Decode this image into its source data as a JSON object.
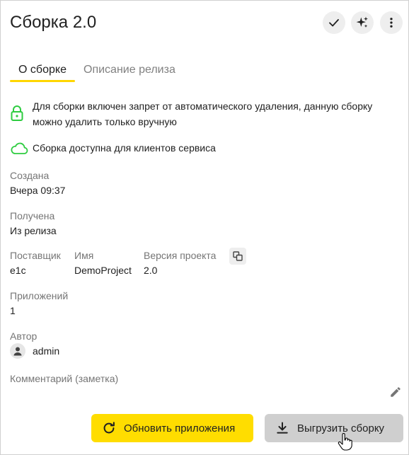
{
  "header": {
    "title": "Сборка 2.0",
    "actions": [
      {
        "name": "check-icon"
      },
      {
        "name": "sparkle-icon"
      },
      {
        "name": "more-vertical-icon"
      }
    ]
  },
  "tabs": [
    {
      "label": "О сборке",
      "active": true
    },
    {
      "label": "Описание релиза",
      "active": false
    }
  ],
  "notices": {
    "deletion_lock": "Для сборки включен запрет от автоматического удаления, данную сборку можно удалить только вручную",
    "availability": "Сборка доступна для клиентов сервиса"
  },
  "fields": {
    "created": {
      "label": "Создана",
      "value": "Вчера 09:37"
    },
    "received": {
      "label": "Получена",
      "value": "Из релиза"
    },
    "vendor": {
      "label": "Поставщик",
      "value": "e1c"
    },
    "name": {
      "label": "Имя",
      "value": "DemoProject"
    },
    "project_version": {
      "label": "Версия проекта",
      "value": "2.0"
    },
    "apps_count": {
      "label": "Приложений",
      "value": "1"
    },
    "author": {
      "label": "Автор",
      "value": "admin"
    },
    "comment": {
      "label": "Комментарий (заметка)",
      "value": ""
    }
  },
  "buttons": {
    "update_apps": "Обновить приложения",
    "export_build": "Выгрузить сборку"
  },
  "colors": {
    "accent": "#ffdd00",
    "tab_underline": "#ffd600",
    "success": "#2ecc40",
    "muted_text": "#757575"
  }
}
